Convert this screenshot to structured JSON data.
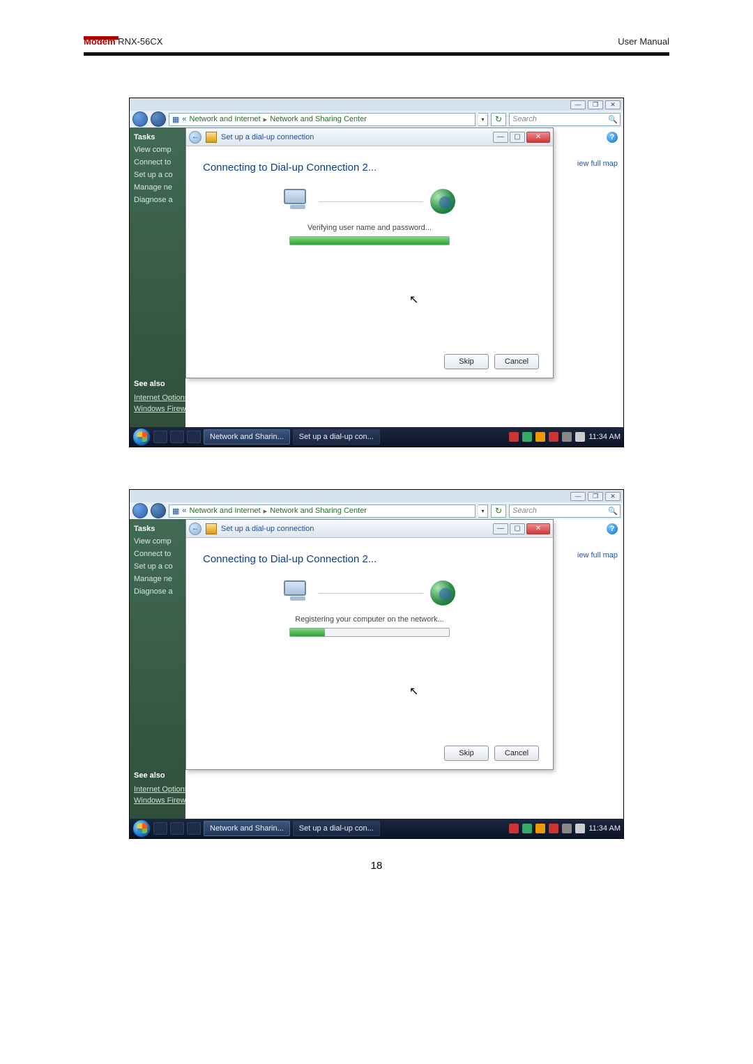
{
  "header": {
    "modem_label": "Modem",
    "product": " RNX-56CX",
    "right": "User  Manual"
  },
  "page_number": "18",
  "breadcrumb": {
    "chevron": "«",
    "seg1": "Network and Internet",
    "sep": "▸",
    "seg2": "Network and Sharing Center"
  },
  "search": {
    "placeholder": "Search"
  },
  "sidebar": {
    "tasks": "Tasks",
    "items": [
      "View comp",
      "Connect to",
      "Set up a co",
      "Manage ne",
      "Diagnose a"
    ],
    "see_also": "See also",
    "sa_items": [
      "Internet Options",
      "Windows Firewall"
    ]
  },
  "content": {
    "view_full_map": "iew full map"
  },
  "dialog": {
    "title": "Set up a dial-up connection",
    "heading": "Connecting to Dial-up Connection 2...",
    "skip": "Skip",
    "cancel": "Cancel",
    "win_min": "—",
    "win_max": "▢",
    "win_close": "✕"
  },
  "shots": [
    {
      "status": "Verifying user name and password...",
      "progress_pct": 100
    },
    {
      "status": "Registering your computer on the network...",
      "progress_pct": 22
    }
  ],
  "titlebar": {
    "min": "—",
    "restore": "❐",
    "close": "✕"
  },
  "taskbar": {
    "btn1": "Network and Sharin...",
    "btn2": "Set up a dial-up con...",
    "time": "11:34 AM"
  }
}
